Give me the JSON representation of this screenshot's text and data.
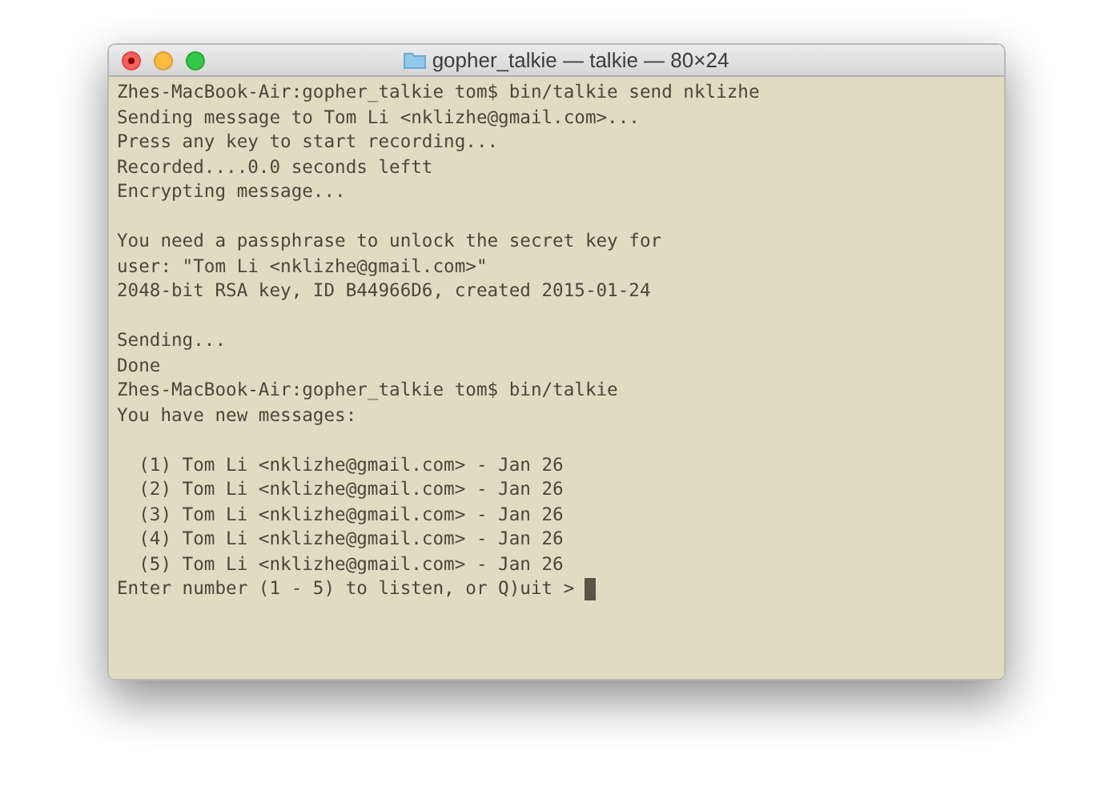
{
  "window": {
    "title": "gopher_talkie — talkie — 80×24"
  },
  "terminal": {
    "lines": [
      {
        "kind": "text",
        "text": "Zhes-MacBook-Air:gopher_talkie tom$ bin/talkie send nklizhe"
      },
      {
        "kind": "text",
        "text": "Sending message to Tom Li <nklizhe@gmail.com>..."
      },
      {
        "kind": "text",
        "text": "Press any key to start recording..."
      },
      {
        "kind": "text",
        "text": "Recorded....0.0 seconds leftt"
      },
      {
        "kind": "text",
        "text": "Encrypting message..."
      },
      {
        "kind": "blank"
      },
      {
        "kind": "text",
        "text": "You need a passphrase to unlock the secret key for"
      },
      {
        "kind": "text",
        "text": "user: \"Tom Li <nklizhe@gmail.com>\""
      },
      {
        "kind": "text",
        "text": "2048-bit RSA key, ID B44966D6, created 2015-01-24"
      },
      {
        "kind": "blank"
      },
      {
        "kind": "text",
        "text": "Sending..."
      },
      {
        "kind": "text",
        "text": "Done"
      },
      {
        "kind": "text",
        "text": "Zhes-MacBook-Air:gopher_talkie tom$ bin/talkie"
      },
      {
        "kind": "text",
        "text": "You have new messages:"
      },
      {
        "kind": "blank"
      },
      {
        "kind": "text",
        "text": "  (1) Tom Li <nklizhe@gmail.com> - Jan 26"
      },
      {
        "kind": "text",
        "text": "  (2) Tom Li <nklizhe@gmail.com> - Jan 26"
      },
      {
        "kind": "text",
        "text": "  (3) Tom Li <nklizhe@gmail.com> - Jan 26"
      },
      {
        "kind": "text",
        "text": "  (4) Tom Li <nklizhe@gmail.com> - Jan 26"
      },
      {
        "kind": "text",
        "text": "  (5) Tom Li <nklizhe@gmail.com> - Jan 26"
      },
      {
        "kind": "prompt",
        "text": "Enter number (1 - 5) to listen, or Q)uit > "
      }
    ]
  }
}
